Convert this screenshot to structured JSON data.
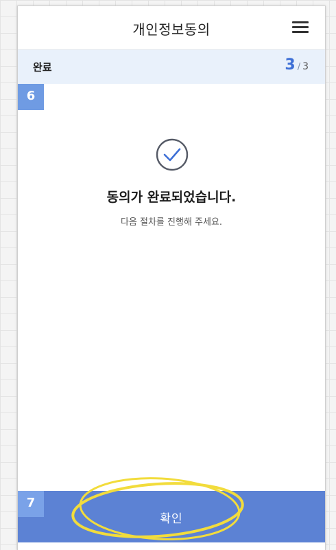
{
  "header": {
    "title": "개인정보동의",
    "menu_icon": "hamburger-menu-icon"
  },
  "step": {
    "label": "완료",
    "current": "3",
    "separator": "/",
    "total": "3"
  },
  "markers": {
    "first": "6",
    "second": "7"
  },
  "result": {
    "icon": "check-circle-icon",
    "title": "동의가 완료되었습니다.",
    "subtitle": "다음 절차를 진행해 주세요."
  },
  "footer": {
    "confirm_label": "확인"
  },
  "colors": {
    "accent": "#3d6fd6",
    "step_bar_bg": "#e9f1fb",
    "confirm_bg": "#5c82d4",
    "marker_bg": "#6f9be3",
    "highlight": "#f2dc3c"
  }
}
